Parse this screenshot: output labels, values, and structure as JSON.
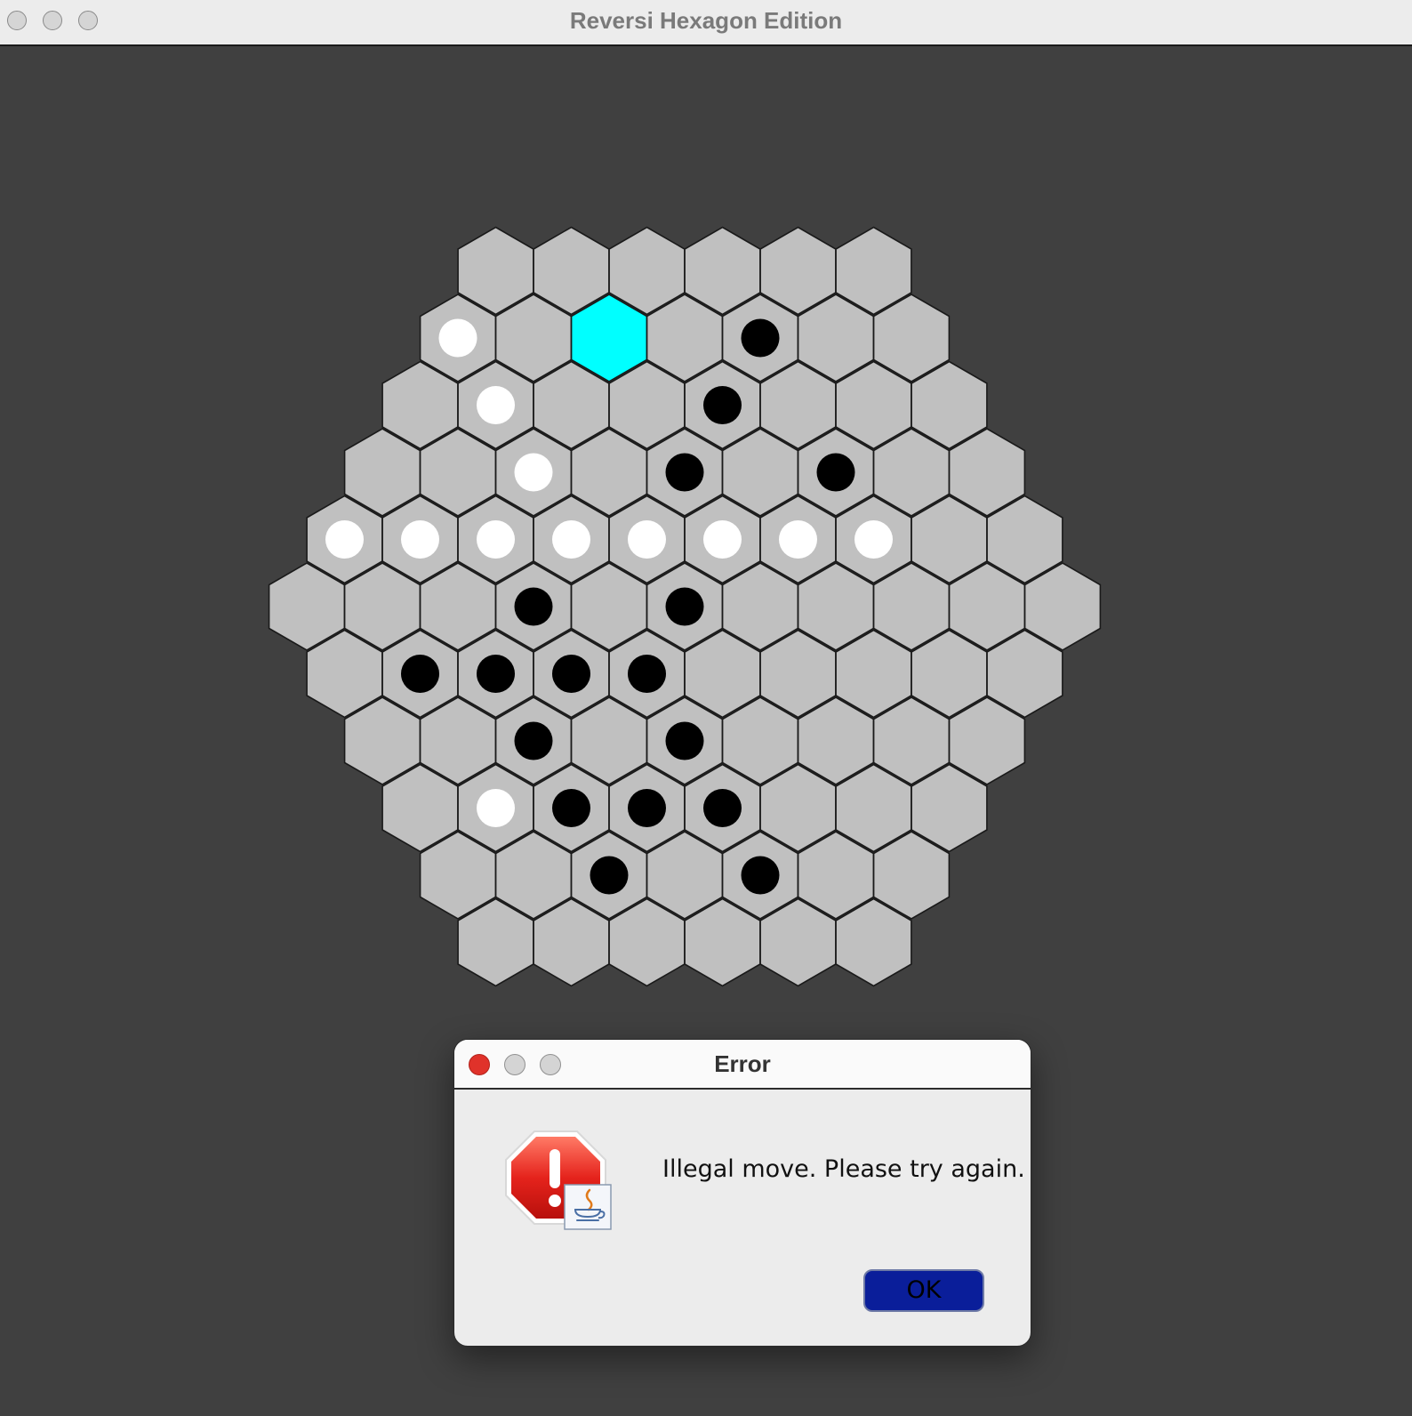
{
  "window": {
    "title": "Reversi Hexagon Edition"
  },
  "board": {
    "colors": {
      "cell": "#c0c0c0",
      "highlight": "#00ffff",
      "outline": "#1a1a1a",
      "white_piece": "#ffffff",
      "black_piece": "#000000"
    },
    "rows": [
      "......",
      "W.H.B..",
      ".W..B...",
      "..W.B.B..",
      "WWWWWWWW..",
      "...B.B.....",
      ".BBBB.....",
      "..B.B....",
      ".WBBB...",
      "..B.B..",
      "......"
    ],
    "legend": {
      ".": "empty",
      "W": "white",
      "B": "black",
      "H": "highlighted-empty"
    }
  },
  "dialog": {
    "title": "Error",
    "message": "Illegal move. Please try again.",
    "ok_label": "OK",
    "icon": "error-stop-icon",
    "badge_icon": "java-cup-icon"
  }
}
